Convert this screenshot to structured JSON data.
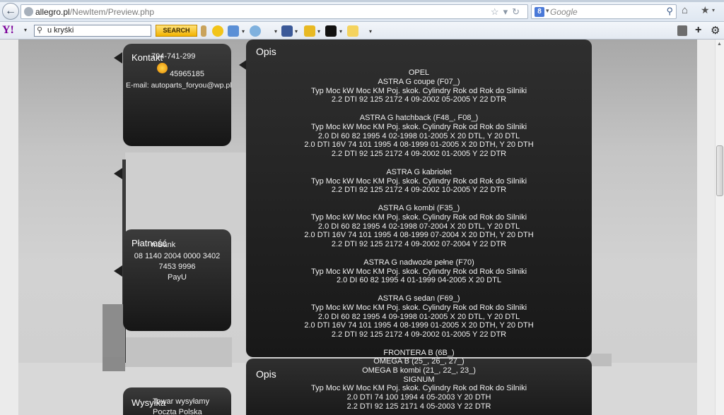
{
  "browser": {
    "url_domain": "allegro.pl",
    "url_path": "/NewItem/Preview.php",
    "search_engine_placeholder": "Google"
  },
  "yahoo_toolbar": {
    "search_value": "u kryśki",
    "search_button": "SEARCH"
  },
  "icons": {
    "back": "back-arrow-icon",
    "home": "home-icon",
    "bookmarks": "bookmark-star-icon"
  },
  "contact_card": {
    "heading": "Kontakt",
    "phone": "794-741-299",
    "gg_number": "45965185",
    "email": "E-mail: autoparts_foryou@wp.pl"
  },
  "payment_card": {
    "heading": "Płatność",
    "bank": "mBank",
    "account_line1": "08 1140 2004 0000 3402",
    "account_line2": "7453 9996",
    "payu": "PayU"
  },
  "shipping_card": {
    "heading": "Wysyłka",
    "line1": "Towar wysyłamy",
    "line2": "Poczta Polska"
  },
  "description_panel": {
    "heading": "Opis",
    "lines": [
      "OPEL",
      "ASTRA G coupe (F07_)",
      "Typ Moc kW Moc KM Poj. skok. Cylindry Rok od Rok do Silniki",
      "2.2 DTI 92 125 2172 4 09-2002 05-2005 Y 22 DTR",
      "",
      "ASTRA G hatchback (F48_, F08_)",
      "Typ Moc kW Moc KM Poj. skok. Cylindry Rok od Rok do Silniki",
      "2.0 DI 60 82 1995 4 02-1998 01-2005 X 20 DTL, Y 20 DTL",
      "2.0 DTI 16V 74 101 1995 4 08-1999 01-2005 X 20 DTH, Y 20 DTH",
      "2.2 DTI 92 125 2172 4 09-2002 01-2005 Y 22 DTR",
      "",
      "ASTRA G kabriolet",
      "Typ Moc kW Moc KM Poj. skok. Cylindry Rok od Rok do Silniki",
      "2.2 DTI 92 125 2172 4 09-2002 10-2005 Y 22 DTR",
      "",
      "ASTRA G kombi (F35_)",
      "Typ Moc kW Moc KM Poj. skok. Cylindry Rok od Rok do Silniki",
      "2.0 DI 60 82 1995 4 02-1998 07-2004 X 20 DTL, Y 20 DTL",
      "2.0 DTI 16V 74 101 1995 4 08-1999 07-2004 X 20 DTH, Y 20 DTH",
      "2.2 DTI 92 125 2172 4 09-2002 07-2004 Y 22 DTR",
      "",
      "ASTRA G nadwozie pełne (F70)",
      "Typ Moc kW Moc KM Poj. skok. Cylindry Rok od Rok do Silniki",
      "2.0 DI 60 82 1995 4 01-1999 04-2005 X 20 DTL",
      "",
      "ASTRA G sedan (F69_)",
      "Typ Moc kW Moc KM Poj. skok. Cylindry Rok od Rok do Silniki",
      "2.0 DI 60 82 1995 4 09-1998 01-2005 X 20 DTL, Y 20 DTL",
      "2.0 DTI 16V 74 101 1995 4 08-1999 01-2005 X 20 DTH, Y 20 DTH",
      "2.2 DTI 92 125 2172 4 09-2002 01-2005 Y 22 DTR",
      "",
      "FRONTERA B (6B_)"
    ]
  },
  "description_panel_2": {
    "heading": "Opis",
    "lines": [
      "OMEGA B (25_, 26_, 27_)",
      "OMEGA B kombi (21_, 22_, 23_)",
      "SIGNUM",
      "Typ Moc kW Moc KM Poj. skok. Cylindry Rok od Rok do Silniki",
      "2.0 DTI 74 100 1994 4 05-2003 Y 20 DTH",
      "2.2 DTI 92 125 2171 4 05-2003 Y 22 DTR"
    ]
  }
}
